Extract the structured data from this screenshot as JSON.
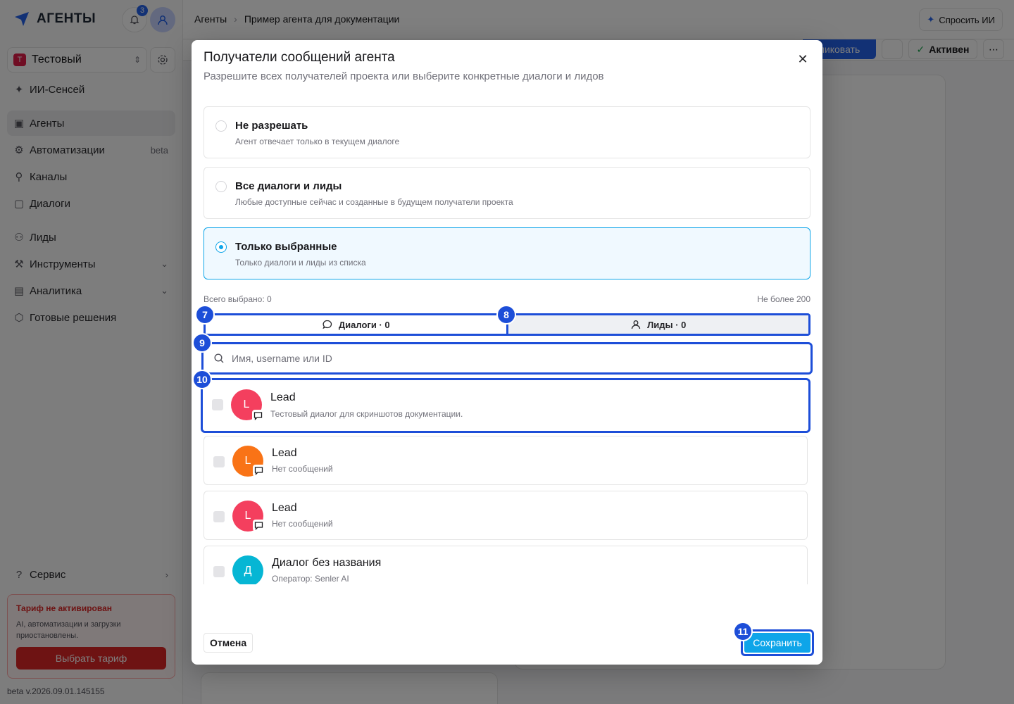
{
  "app": {
    "brand": "АГЕНТЫ",
    "notifications_count": "3",
    "project_name": "Тестовый",
    "project_initial": "Т",
    "version": "beta v.2026.09.01.145155"
  },
  "sidebar": {
    "items": [
      {
        "label": "ИИ-Сенсей",
        "icon": "sparkle-icon"
      },
      {
        "label": "Агенты",
        "icon": "bot-icon",
        "active": true
      },
      {
        "label": "Автоматизации",
        "icon": "automation-icon",
        "tail": "beta"
      },
      {
        "label": "Каналы",
        "icon": "channels-icon"
      },
      {
        "label": "Диалоги",
        "icon": "dialogs-icon"
      },
      {
        "label": "Лиды",
        "icon": "user-icon"
      },
      {
        "label": "Инструменты",
        "icon": "tools-icon",
        "tail": "⌄"
      },
      {
        "label": "Аналитика",
        "icon": "analytics-icon",
        "tail": "⌄"
      },
      {
        "label": "Готовые решения",
        "icon": "box-icon"
      },
      {
        "label": "Сервис",
        "icon": "help-icon",
        "tail": "›"
      }
    ],
    "tariff": {
      "title": "Тариф не активирован",
      "text": "AI, автоматизации и загрузки приостановлены.",
      "button": "Выбрать тариф"
    }
  },
  "header": {
    "breadcrumb_root": "Агенты",
    "breadcrumb_current": "Пример агента для документации",
    "ask_ai": "Спросить ИИ",
    "publish": "ликовать",
    "status": "Активен",
    "more": "⋯"
  },
  "modal": {
    "title": "Получатели сообщений агента",
    "subtitle": "Разрешите всех получателей проекта или выберите конкретные диалоги и лидов",
    "options": [
      {
        "title": "Не разрешать",
        "desc": "Агент отвечает только в текущем диалоге",
        "selected": false
      },
      {
        "title": "Все диалоги и лиды",
        "desc": "Любые доступные сейчас и созданные в будущем получатели проекта",
        "selected": false
      },
      {
        "title": "Только выбранные",
        "desc": "Только диалоги и лиды из списка",
        "selected": true
      }
    ],
    "total_selected": "Всего выбрано: 0",
    "limit": "Не более 200",
    "tabs": [
      {
        "label": "Диалоги · 0",
        "icon": "chat-bubble-icon"
      },
      {
        "label": "Лиды · 0",
        "icon": "user-icon"
      }
    ],
    "search_placeholder": "Имя, username или ID",
    "items": [
      {
        "initial": "L",
        "title": "Lead",
        "desc": "Тестовый диалог для скриншотов документации.",
        "color": "#f43f5e"
      },
      {
        "initial": "L",
        "title": "Lead",
        "desc": "Нет сообщений",
        "color": "#f97316"
      },
      {
        "initial": "L",
        "title": "Lead",
        "desc": "Нет сообщений",
        "color": "#f43f5e"
      },
      {
        "initial": "Д",
        "title": "Диалог без названия",
        "desc": "Оператор: Senler AI",
        "color": "#06b6d4"
      }
    ],
    "cancel": "Отмена",
    "save": "Сохранить"
  },
  "markers": [
    "7",
    "8",
    "9",
    "10",
    "11"
  ]
}
